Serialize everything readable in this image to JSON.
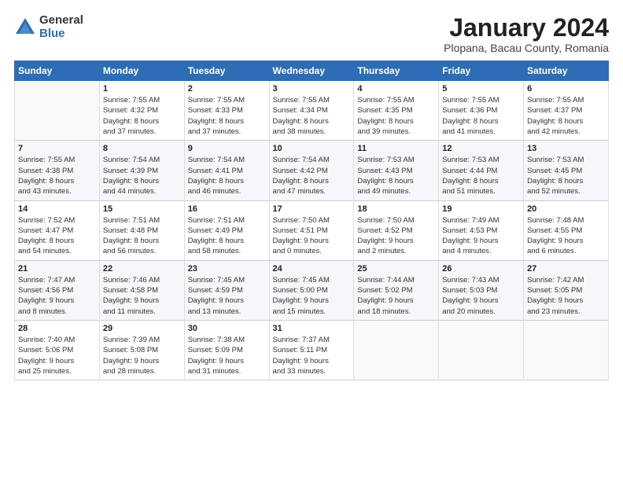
{
  "header": {
    "logo_general": "General",
    "logo_blue": "Blue",
    "title": "January 2024",
    "location": "Plopana, Bacau County, Romania"
  },
  "days_of_week": [
    "Sunday",
    "Monday",
    "Tuesday",
    "Wednesday",
    "Thursday",
    "Friday",
    "Saturday"
  ],
  "weeks": [
    [
      {
        "day": "",
        "content": ""
      },
      {
        "day": "1",
        "content": "Sunrise: 7:55 AM\nSunset: 4:32 PM\nDaylight: 8 hours\nand 37 minutes."
      },
      {
        "day": "2",
        "content": "Sunrise: 7:55 AM\nSunset: 4:33 PM\nDaylight: 8 hours\nand 37 minutes."
      },
      {
        "day": "3",
        "content": "Sunrise: 7:55 AM\nSunset: 4:34 PM\nDaylight: 8 hours\nand 38 minutes."
      },
      {
        "day": "4",
        "content": "Sunrise: 7:55 AM\nSunset: 4:35 PM\nDaylight: 8 hours\nand 39 minutes."
      },
      {
        "day": "5",
        "content": "Sunrise: 7:55 AM\nSunset: 4:36 PM\nDaylight: 8 hours\nand 41 minutes."
      },
      {
        "day": "6",
        "content": "Sunrise: 7:55 AM\nSunset: 4:37 PM\nDaylight: 8 hours\nand 42 minutes."
      }
    ],
    [
      {
        "day": "7",
        "content": "Sunrise: 7:55 AM\nSunset: 4:38 PM\nDaylight: 8 hours\nand 43 minutes."
      },
      {
        "day": "8",
        "content": "Sunrise: 7:54 AM\nSunset: 4:39 PM\nDaylight: 8 hours\nand 44 minutes."
      },
      {
        "day": "9",
        "content": "Sunrise: 7:54 AM\nSunset: 4:41 PM\nDaylight: 8 hours\nand 46 minutes."
      },
      {
        "day": "10",
        "content": "Sunrise: 7:54 AM\nSunset: 4:42 PM\nDaylight: 8 hours\nand 47 minutes."
      },
      {
        "day": "11",
        "content": "Sunrise: 7:53 AM\nSunset: 4:43 PM\nDaylight: 8 hours\nand 49 minutes."
      },
      {
        "day": "12",
        "content": "Sunrise: 7:53 AM\nSunset: 4:44 PM\nDaylight: 8 hours\nand 51 minutes."
      },
      {
        "day": "13",
        "content": "Sunrise: 7:53 AM\nSunset: 4:45 PM\nDaylight: 8 hours\nand 52 minutes."
      }
    ],
    [
      {
        "day": "14",
        "content": "Sunrise: 7:52 AM\nSunset: 4:47 PM\nDaylight: 8 hours\nand 54 minutes."
      },
      {
        "day": "15",
        "content": "Sunrise: 7:51 AM\nSunset: 4:48 PM\nDaylight: 8 hours\nand 56 minutes."
      },
      {
        "day": "16",
        "content": "Sunrise: 7:51 AM\nSunset: 4:49 PM\nDaylight: 8 hours\nand 58 minutes."
      },
      {
        "day": "17",
        "content": "Sunrise: 7:50 AM\nSunset: 4:51 PM\nDaylight: 9 hours\nand 0 minutes."
      },
      {
        "day": "18",
        "content": "Sunrise: 7:50 AM\nSunset: 4:52 PM\nDaylight: 9 hours\nand 2 minutes."
      },
      {
        "day": "19",
        "content": "Sunrise: 7:49 AM\nSunset: 4:53 PM\nDaylight: 9 hours\nand 4 minutes."
      },
      {
        "day": "20",
        "content": "Sunrise: 7:48 AM\nSunset: 4:55 PM\nDaylight: 9 hours\nand 6 minutes."
      }
    ],
    [
      {
        "day": "21",
        "content": "Sunrise: 7:47 AM\nSunset: 4:56 PM\nDaylight: 9 hours\nand 8 minutes."
      },
      {
        "day": "22",
        "content": "Sunrise: 7:46 AM\nSunset: 4:58 PM\nDaylight: 9 hours\nand 11 minutes."
      },
      {
        "day": "23",
        "content": "Sunrise: 7:45 AM\nSunset: 4:59 PM\nDaylight: 9 hours\nand 13 minutes."
      },
      {
        "day": "24",
        "content": "Sunrise: 7:45 AM\nSunset: 5:00 PM\nDaylight: 9 hours\nand 15 minutes."
      },
      {
        "day": "25",
        "content": "Sunrise: 7:44 AM\nSunset: 5:02 PM\nDaylight: 9 hours\nand 18 minutes."
      },
      {
        "day": "26",
        "content": "Sunrise: 7:43 AM\nSunset: 5:03 PM\nDaylight: 9 hours\nand 20 minutes."
      },
      {
        "day": "27",
        "content": "Sunrise: 7:42 AM\nSunset: 5:05 PM\nDaylight: 9 hours\nand 23 minutes."
      }
    ],
    [
      {
        "day": "28",
        "content": "Sunrise: 7:40 AM\nSunset: 5:06 PM\nDaylight: 9 hours\nand 25 minutes."
      },
      {
        "day": "29",
        "content": "Sunrise: 7:39 AM\nSunset: 5:08 PM\nDaylight: 9 hours\nand 28 minutes."
      },
      {
        "day": "30",
        "content": "Sunrise: 7:38 AM\nSunset: 5:09 PM\nDaylight: 9 hours\nand 31 minutes."
      },
      {
        "day": "31",
        "content": "Sunrise: 7:37 AM\nSunset: 5:11 PM\nDaylight: 9 hours\nand 33 minutes."
      },
      {
        "day": "",
        "content": ""
      },
      {
        "day": "",
        "content": ""
      },
      {
        "day": "",
        "content": ""
      }
    ]
  ]
}
